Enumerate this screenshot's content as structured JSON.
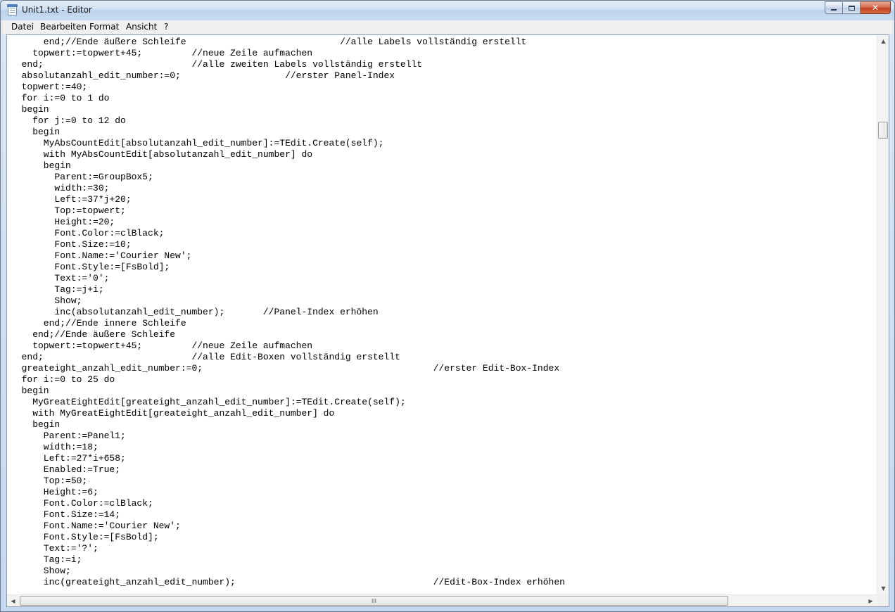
{
  "window": {
    "title": "Unit1.txt - Editor",
    "close_glyph": "✕"
  },
  "menubar": {
    "items": [
      "Datei",
      "Bearbeiten",
      "Format",
      "Ansicht",
      "?"
    ]
  },
  "icons": {
    "app": "notepad-icon",
    "up": "▲",
    "down": "▼",
    "left": "◀",
    "right": "▶",
    "grip": "III"
  },
  "colors": {
    "title_bg": "#cfdff1",
    "close_button": "#c3401f",
    "editor_bg": "#ffffff"
  },
  "editor": {
    "lines": [
      "      end;//Ende äußere Schleife                            //alle Labels vollständig erstellt",
      "    topwert:=topwert+45;         //neue Zeile aufmachen",
      "  end;                           //alle zweiten Labels vollständig erstellt",
      "  absolutanzahl_edit_number:=0;                   //erster Panel-Index",
      "  topwert:=40;",
      "  for i:=0 to 1 do",
      "  begin",
      "    for j:=0 to 12 do",
      "    begin",
      "      MyAbsCountEdit[absolutanzahl_edit_number]:=TEdit.Create(self);",
      "      with MyAbsCountEdit[absolutanzahl_edit_number] do",
      "      begin",
      "        Parent:=GroupBox5;",
      "        width:=30;",
      "        Left:=37*j+20;",
      "        Top:=topwert;",
      "        Height:=20;",
      "        Font.Color:=clBlack;",
      "        Font.Size:=10;",
      "        Font.Name:='Courier New';",
      "        Font.Style:=[FsBold];",
      "        Text:='0';",
      "        Tag:=j+i;",
      "        Show;",
      "        inc(absolutanzahl_edit_number);       //Panel-Index erhöhen",
      "      end;//Ende innere Schleife",
      "    end;//Ende äußere Schleife",
      "    topwert:=topwert+45;         //neue Zeile aufmachen",
      "  end;                           //alle Edit-Boxen vollständig erstellt",
      "  greateight_anzahl_edit_number:=0;                                          //erster Edit-Box-Index",
      "  for i:=0 to 25 do",
      "  begin",
      "    MyGreatEightEdit[greateight_anzahl_edit_number]:=TEdit.Create(self);",
      "    with MyGreatEightEdit[greateight_anzahl_edit_number] do",
      "    begin",
      "      Parent:=Panel1;",
      "      width:=18;",
      "      Left:=27*i+658;",
      "      Enabled:=True;",
      "      Top:=50;",
      "      Height:=6;",
      "      Font.Color:=clBlack;",
      "      Font.Size:=14;",
      "      Font.Name:='Courier New';",
      "      Font.Style:=[FsBold];",
      "      Text:='?';",
      "      Tag:=i;",
      "      Show;",
      "      inc(greateight_anzahl_edit_number);                                    //Edit-Box-Index erhöhen"
    ]
  }
}
